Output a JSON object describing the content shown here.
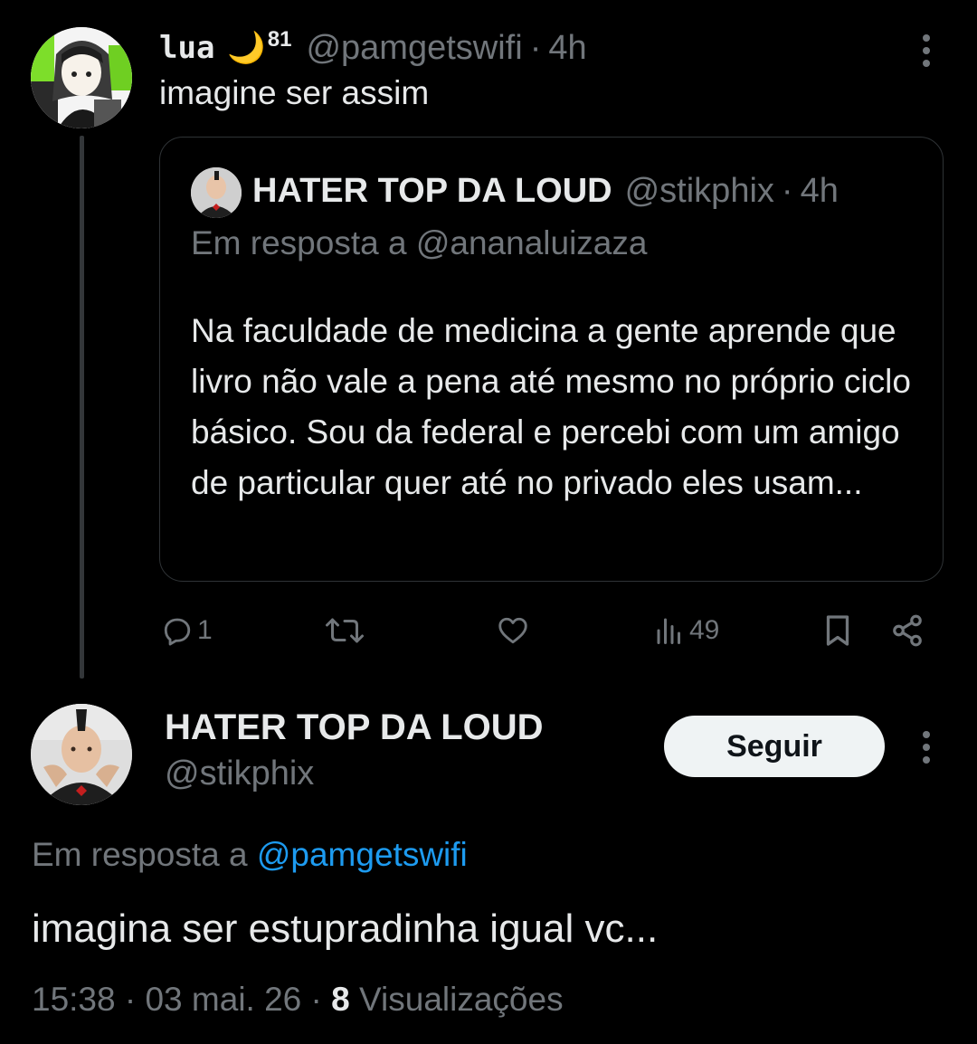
{
  "colors": {
    "background": "#000000",
    "text_primary": "#e7e9ea",
    "text_secondary": "#71767b",
    "accent_link": "#1d9bf0",
    "border": "#2f3336",
    "follow_button_bg": "#eff3f4"
  },
  "thread_tweet": {
    "display_name": "lua",
    "emoji": "🌙",
    "emoji_badge": "81",
    "handle": "@pamgetswifi",
    "separator": "·",
    "time": "4h",
    "text": "imagine ser assim",
    "more_icon": "more-vertical-icon",
    "quoted_tweet": {
      "display_name": "HATER TOP DA LOUD",
      "handle": "@stikphix",
      "separator": "·",
      "time": "4h",
      "reply_prefix": "Em resposta a",
      "reply_handle": "@ananaluizaza",
      "body": "Na faculdade de medicina a gente aprende que livro não vale a pena até mesmo no próprio ciclo básico. Sou da federal e percebi com um amigo de particular quer até no privado eles usam..."
    },
    "actions": {
      "reply": {
        "icon": "reply-icon",
        "count": "1"
      },
      "retweet": {
        "icon": "retweet-icon",
        "count": ""
      },
      "like": {
        "icon": "heart-icon",
        "count": ""
      },
      "views": {
        "icon": "views-icon",
        "count": "49"
      },
      "bookmark": {
        "icon": "bookmark-icon"
      },
      "share": {
        "icon": "share-icon"
      }
    }
  },
  "main_tweet": {
    "display_name": "HATER TOP DA LOUD",
    "handle": "@stikphix",
    "follow_label": "Seguir",
    "more_icon": "more-vertical-icon",
    "reply_prefix": "Em resposta a",
    "reply_handle": "@pamgetswifi",
    "text": "imagina ser estupradinha igual vc...",
    "time": "15:38",
    "date": "03 mai. 26",
    "separator": "·",
    "views_count": "8",
    "views_label": "Visualizações"
  }
}
